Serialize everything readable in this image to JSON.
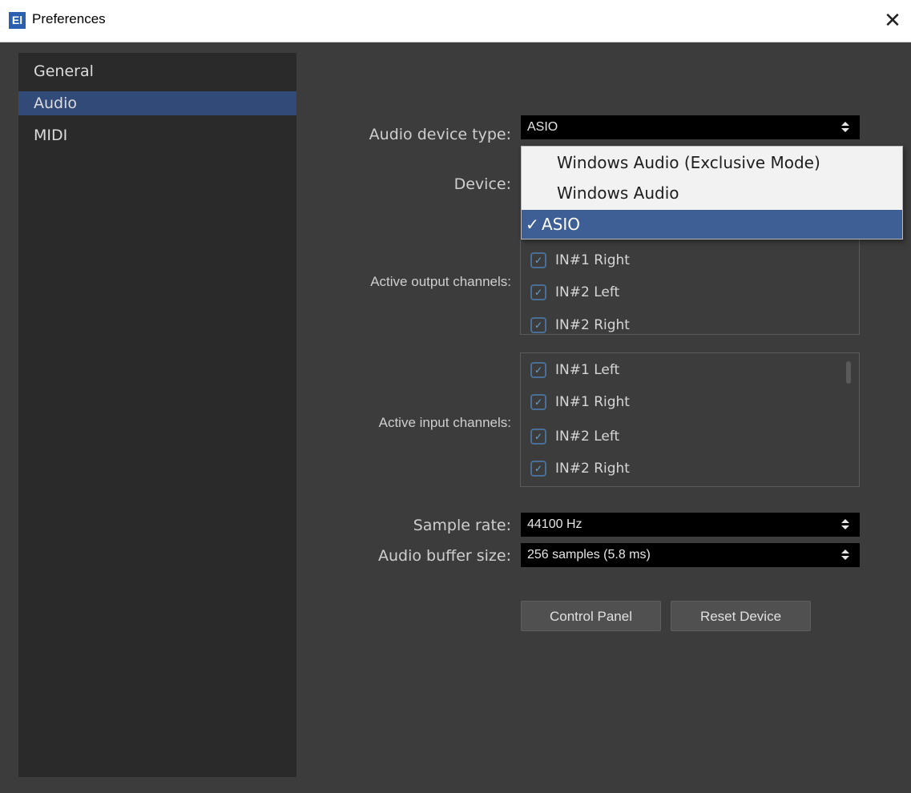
{
  "window": {
    "logo_text": "El",
    "title": "Preferences",
    "close_glyph": "✕"
  },
  "sidebar": {
    "items": [
      {
        "label": "General",
        "selected": false
      },
      {
        "label": "Audio",
        "selected": true
      },
      {
        "label": "MIDI",
        "selected": false
      }
    ]
  },
  "audio": {
    "device_type_label": "Audio device type:",
    "device_type_value": "ASIO",
    "device_label": "Device:",
    "output_label": "Active output channels:",
    "output_channels": [
      {
        "label": "IN#1 Right",
        "checked": true
      },
      {
        "label": "IN#2 Left",
        "checked": true
      },
      {
        "label": "IN#2 Right",
        "checked": true
      }
    ],
    "input_label": "Active input channels:",
    "input_channels": [
      {
        "label": "IN#1 Left",
        "checked": true
      },
      {
        "label": "IN#1 Right",
        "checked": true
      },
      {
        "label": "IN#2 Left",
        "checked": true
      },
      {
        "label": "IN#2 Right",
        "checked": true
      }
    ],
    "sample_rate_label": "Sample rate:",
    "sample_rate_value": "44100 Hz",
    "buffer_size_label": "Audio buffer size:",
    "buffer_size_value": "256 samples (5.8 ms)",
    "control_panel_label": "Control Panel",
    "reset_device_label": "Reset Device"
  },
  "dropdown": {
    "options": [
      {
        "label": "Windows Audio (Exclusive Mode)",
        "selected": false
      },
      {
        "label": "Windows Audio",
        "selected": false
      },
      {
        "label": "ASIO",
        "selected": true
      }
    ],
    "check_glyph": "✓"
  },
  "colors": {
    "background": "#3c3c3c",
    "sidebar": "#2a2a2a",
    "selection": "#324a78",
    "dropdown_selection": "#3d5f96"
  }
}
